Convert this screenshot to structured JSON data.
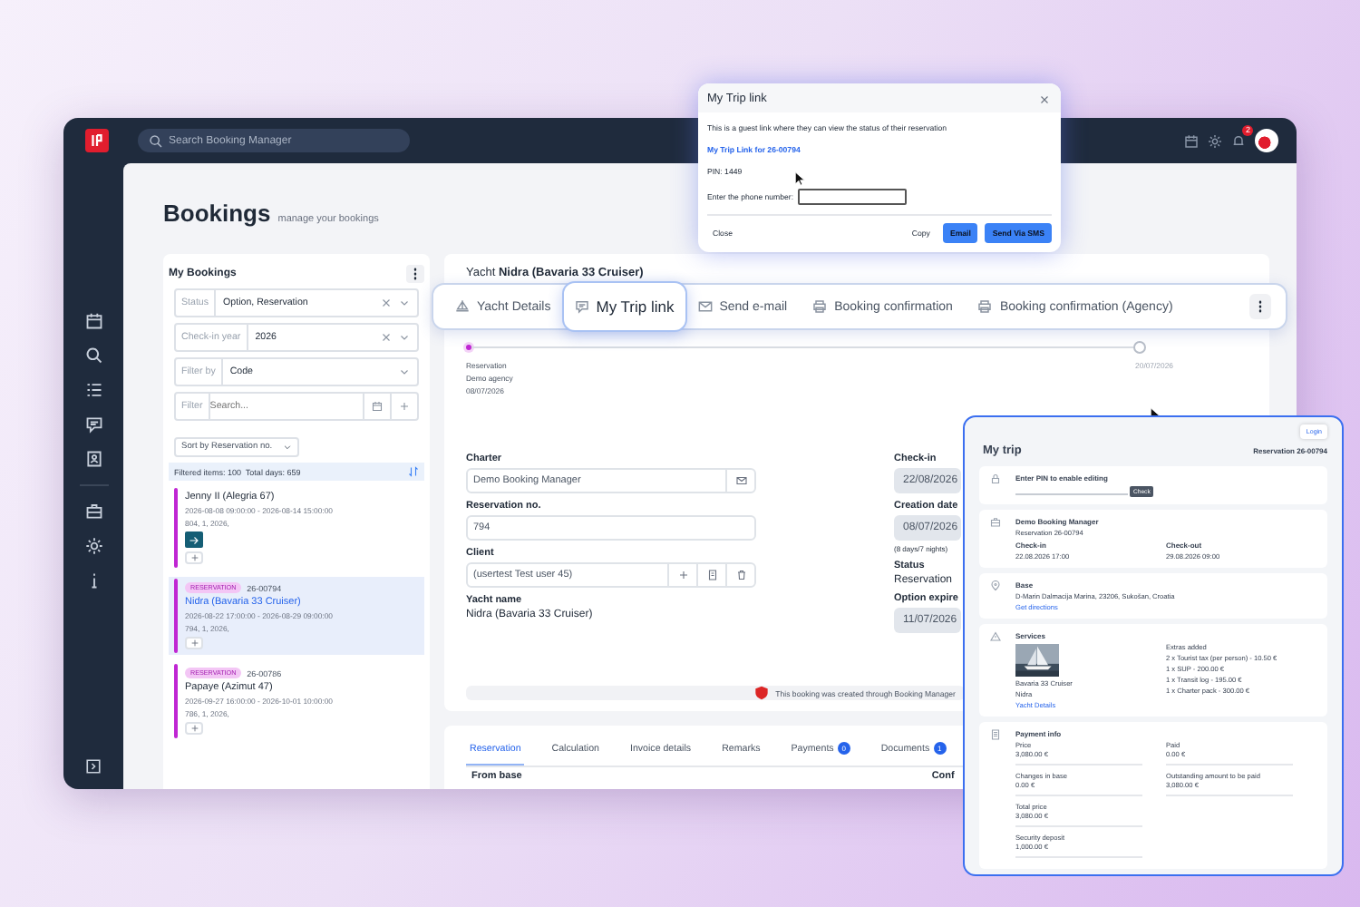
{
  "topbar": {
    "search_placeholder": "Search Booking Manager",
    "notification_badge": "2"
  },
  "page": {
    "title": "Bookings",
    "subtitle": "manage your bookings"
  },
  "my_bookings": {
    "title": "My Bookings",
    "filters": [
      {
        "label": "Status",
        "value": "Option, Reservation",
        "kind": "select",
        "clearable": true
      },
      {
        "label": "Check-in year",
        "value": "2026",
        "kind": "select",
        "clearable": true
      },
      {
        "label": "Filter by",
        "value": "Code",
        "kind": "select",
        "clearable": false
      },
      {
        "label": "Filter",
        "placeholder": "Search...",
        "kind": "search"
      }
    ],
    "sort": "Sort by Reservation no.",
    "summary": "Filtered items: 100  Total days: 659",
    "items": [
      {
        "name": "Jenny II (Alegria 67)",
        "dates": "2026-08-08 09:00:00 - 2026-08-14 15:00:00",
        "meta": "804, 1, 2026,",
        "selected": false,
        "has_arrow": true
      },
      {
        "badge": "RESERVATION",
        "code": "26-00794",
        "name": "Nidra (Bavaria 33 Cruiser)",
        "dates": "2026-08-22 17:00:00 - 2026-08-29 09:00:00",
        "meta": "794, 1, 2026,",
        "selected": true,
        "has_arrow": false
      },
      {
        "badge": "RESERVATION",
        "code": "26-00786",
        "name": "Papaye (Azimut 47)",
        "dates": "2026-09-27 16:00:00 - 2026-10-01 10:00:00",
        "meta": "786, 1, 2026,",
        "selected": false,
        "has_arrow": false
      }
    ]
  },
  "booking": {
    "heading": "Yacht **Nidra (Bavaria 33 Cruiser)**",
    "actions": [
      {
        "label": "Yacht Details",
        "selected": false
      },
      {
        "label": "My Trip link",
        "selected": true
      },
      {
        "label": "Send e-mail",
        "selected": false
      },
      {
        "label": "Booking confirmation",
        "selected": false
      },
      {
        "label": "Booking confirmation (Agency)",
        "selected": false
      }
    ],
    "timeline": {
      "start_lines": [
        "Reservation",
        "Demo agency",
        "08/07/2026"
      ],
      "end_date": "20/07/2026"
    },
    "left_fields": [
      {
        "label": "Charter",
        "value": "Demo Booking Manager",
        "kind": "mail"
      },
      {
        "label": "Reservation no.",
        "value": "794",
        "kind": "plain"
      },
      {
        "label": "Client",
        "value": "(usertest Test user 45)",
        "kind": "client"
      },
      {
        "label": "Yacht name",
        "value": "Nidra (Bavaria 33 Cruiser)",
        "kind": "text"
      }
    ],
    "right_fields": [
      {
        "label": "Check-in",
        "value": "22/08/2026",
        "kind": "date"
      },
      {
        "label": "Creation date",
        "value": "08/07/2026",
        "kind": "date",
        "note": "(8 days/7 nights)"
      },
      {
        "label": "Status",
        "value": "Reservation",
        "kind": "text"
      },
      {
        "label": "Option expire",
        "value": "11/07/2026",
        "kind": "date"
      }
    ],
    "notice": "This booking was created through Booking Manager",
    "tabs": [
      {
        "label": "Reservation",
        "selected": true
      },
      {
        "label": "Calculation",
        "selected": false
      },
      {
        "label": "Invoice details",
        "selected": false
      },
      {
        "label": "Remarks",
        "selected": false
      },
      {
        "label": "Payments",
        "count": "0",
        "selected": false
      },
      {
        "label": "Documents",
        "count": "1",
        "selected": false
      }
    ],
    "section_labels": [
      "From base",
      "Conf"
    ]
  },
  "trip_link_dialog": {
    "title": "My Trip link",
    "description": "This is a guest link where they can view the status of their reservation",
    "link": "My Trip Link for 26-00794",
    "pin": "PIN: 1449",
    "phone_label": "Enter the phone number:",
    "buttons": [
      {
        "label": "Close",
        "kind": "text"
      },
      {
        "label": "Copy",
        "kind": "text"
      },
      {
        "label": "Email",
        "kind": "primary"
      },
      {
        "label": "Send Via SMS",
        "kind": "primary"
      }
    ]
  },
  "my_trip": {
    "login": "Login",
    "title": "My trip",
    "reservation": "Reservation 26-00794",
    "pin_label": "Enter PIN to enable editing",
    "check_button": "Check",
    "company": "Demo Booking Manager",
    "company_sub": "Reservation 26-00794",
    "checkin_label": "Check-in",
    "checkin": "22.08.2026 17:00",
    "checkout_label": "Check-out",
    "checkout": "29.08.2026 09:00",
    "base_label": "Base",
    "base": "D-Marin Dalmacija Marina, 23206, Sukošan, Croatia",
    "directions": "Get directions",
    "services_label": "Services",
    "yacht_model": "Bavaria 33 Cruiser",
    "yacht_name": "Nidra",
    "yacht_link": "Yacht Details",
    "extras_label": "Extras added",
    "extras": [
      "2 x Tourist tax (per person) - 10.50 €",
      "1 x SUP - 200.00 €",
      "1 x Transit log - 195.00 €",
      "1 x Charter pack - 300.00 €"
    ],
    "payment_label": "Payment info",
    "payment_left": [
      {
        "label": "Price",
        "value": "3,080.00 €"
      },
      {
        "label": "Changes in base",
        "value": "0.00 €"
      },
      {
        "label": "Total price",
        "value": "3,080.00 €"
      },
      {
        "label": "Security deposit",
        "value": "1,000.00 €"
      }
    ],
    "payment_right": [
      {
        "label": "Paid",
        "value": "0.00 €"
      },
      {
        "label": "Outstanding amount to be paid",
        "value": "3,080.00 €"
      }
    ]
  }
}
